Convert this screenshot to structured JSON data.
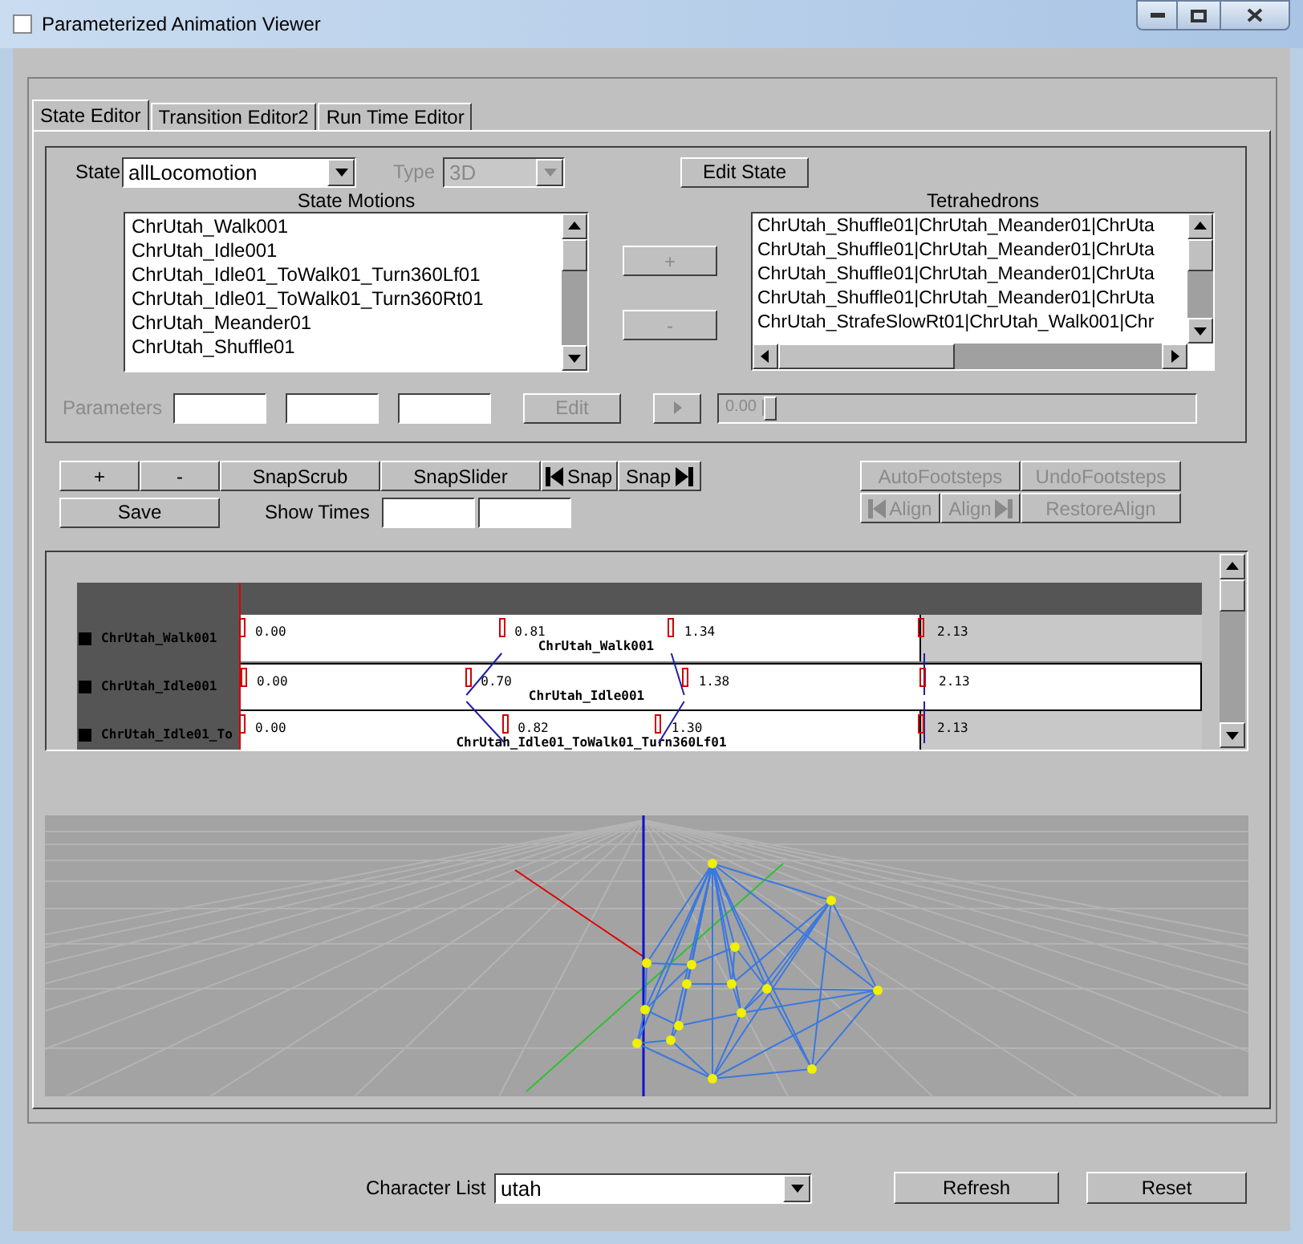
{
  "window": {
    "title": "Parameterized Animation Viewer"
  },
  "tabs": [
    {
      "label": "State Editor",
      "selected": true
    },
    {
      "label": "Transition Editor2",
      "selected": false
    },
    {
      "label": "Run Time Editor",
      "selected": false
    }
  ],
  "state_panel": {
    "state_label": "State",
    "state_value": "allLocomotion",
    "type_label": "Type",
    "type_value": "3D",
    "type_disabled": true,
    "edit_state_button": "Edit State",
    "state_motions": {
      "title": "State Motions",
      "items": [
        "ChrUtah_Walk001",
        "ChrUtah_Idle001",
        "ChrUtah_Idle01_ToWalk01_Turn360Lf01",
        "ChrUtah_Idle01_ToWalk01_Turn360Rt01",
        "ChrUtah_Meander01",
        "ChrUtah_Shuffle01"
      ]
    },
    "add_button": {
      "label": "+",
      "disabled": true
    },
    "remove_button": {
      "label": "-",
      "disabled": true
    },
    "tetrahedrons": {
      "title": "Tetrahedrons",
      "items": [
        "ChrUtah_Shuffle01|ChrUtah_Meander01|ChrUta",
        "ChrUtah_Shuffle01|ChrUtah_Meander01|ChrUta",
        "ChrUtah_Shuffle01|ChrUtah_Meander01|ChrUta",
        "ChrUtah_Shuffle01|ChrUtah_Meander01|ChrUta",
        "ChrUtah_StrafeSlowRt01|ChrUtah_Walk001|Chr"
      ]
    },
    "parameters": {
      "label": "Parameters",
      "disabled": true,
      "edit_button": "Edit",
      "reading": "0.00",
      "level": 0
    }
  },
  "toolbar": {
    "left_buttons": [
      {
        "label": "+",
        "kind": "text",
        "disabled": false
      },
      {
        "label": "-",
        "kind": "text",
        "disabled": false
      },
      {
        "label": "SnapScrub",
        "kind": "text",
        "disabled": false
      },
      {
        "label": "SnapSlider",
        "kind": "text",
        "disabled": false
      },
      {
        "label": "Snap",
        "kind": "icon_left",
        "disabled": false
      },
      {
        "label": "Snap",
        "kind": "icon_right",
        "disabled": false
      }
    ],
    "save_button": "Save",
    "show_times_label": "Show Times",
    "right_buttons": [
      {
        "label": "AutoFootsteps",
        "kind": "text",
        "disabled": true
      },
      {
        "label": "UndoFootsteps",
        "kind": "text",
        "disabled": true
      },
      {
        "label": "Align",
        "kind": "icon_left",
        "disabled": true
      },
      {
        "label": "Align",
        "kind": "icon_right",
        "disabled": true
      },
      {
        "label": "RestoreAlign",
        "kind": "text",
        "disabled": true
      }
    ]
  },
  "timeline": {
    "rows": [
      {
        "name": "ChrUtah_Walk001",
        "selected": false,
        "times": [
          "0.00",
          "0.81",
          "1.34",
          "2.13"
        ],
        "motion_label": "ChrUtah_Walk001"
      },
      {
        "name": "ChrUtah_Idle001",
        "selected": true,
        "times": [
          "0.00",
          "0.70",
          "1.38",
          "2.13"
        ],
        "motion_label": "ChrUtah_Idle001"
      },
      {
        "name": "ChrUtah_Idle01_To",
        "selected": false,
        "times": [
          "0.00",
          "0.82",
          "1.30",
          "2.13"
        ],
        "motion_label": "ChrUtah_Idle01_ToWalk01_Turn360Lf01"
      }
    ]
  },
  "footer": {
    "character_list_label": "Character List",
    "character_value": "utah",
    "refresh_button": "Refresh",
    "reset_button": "Reset"
  }
}
